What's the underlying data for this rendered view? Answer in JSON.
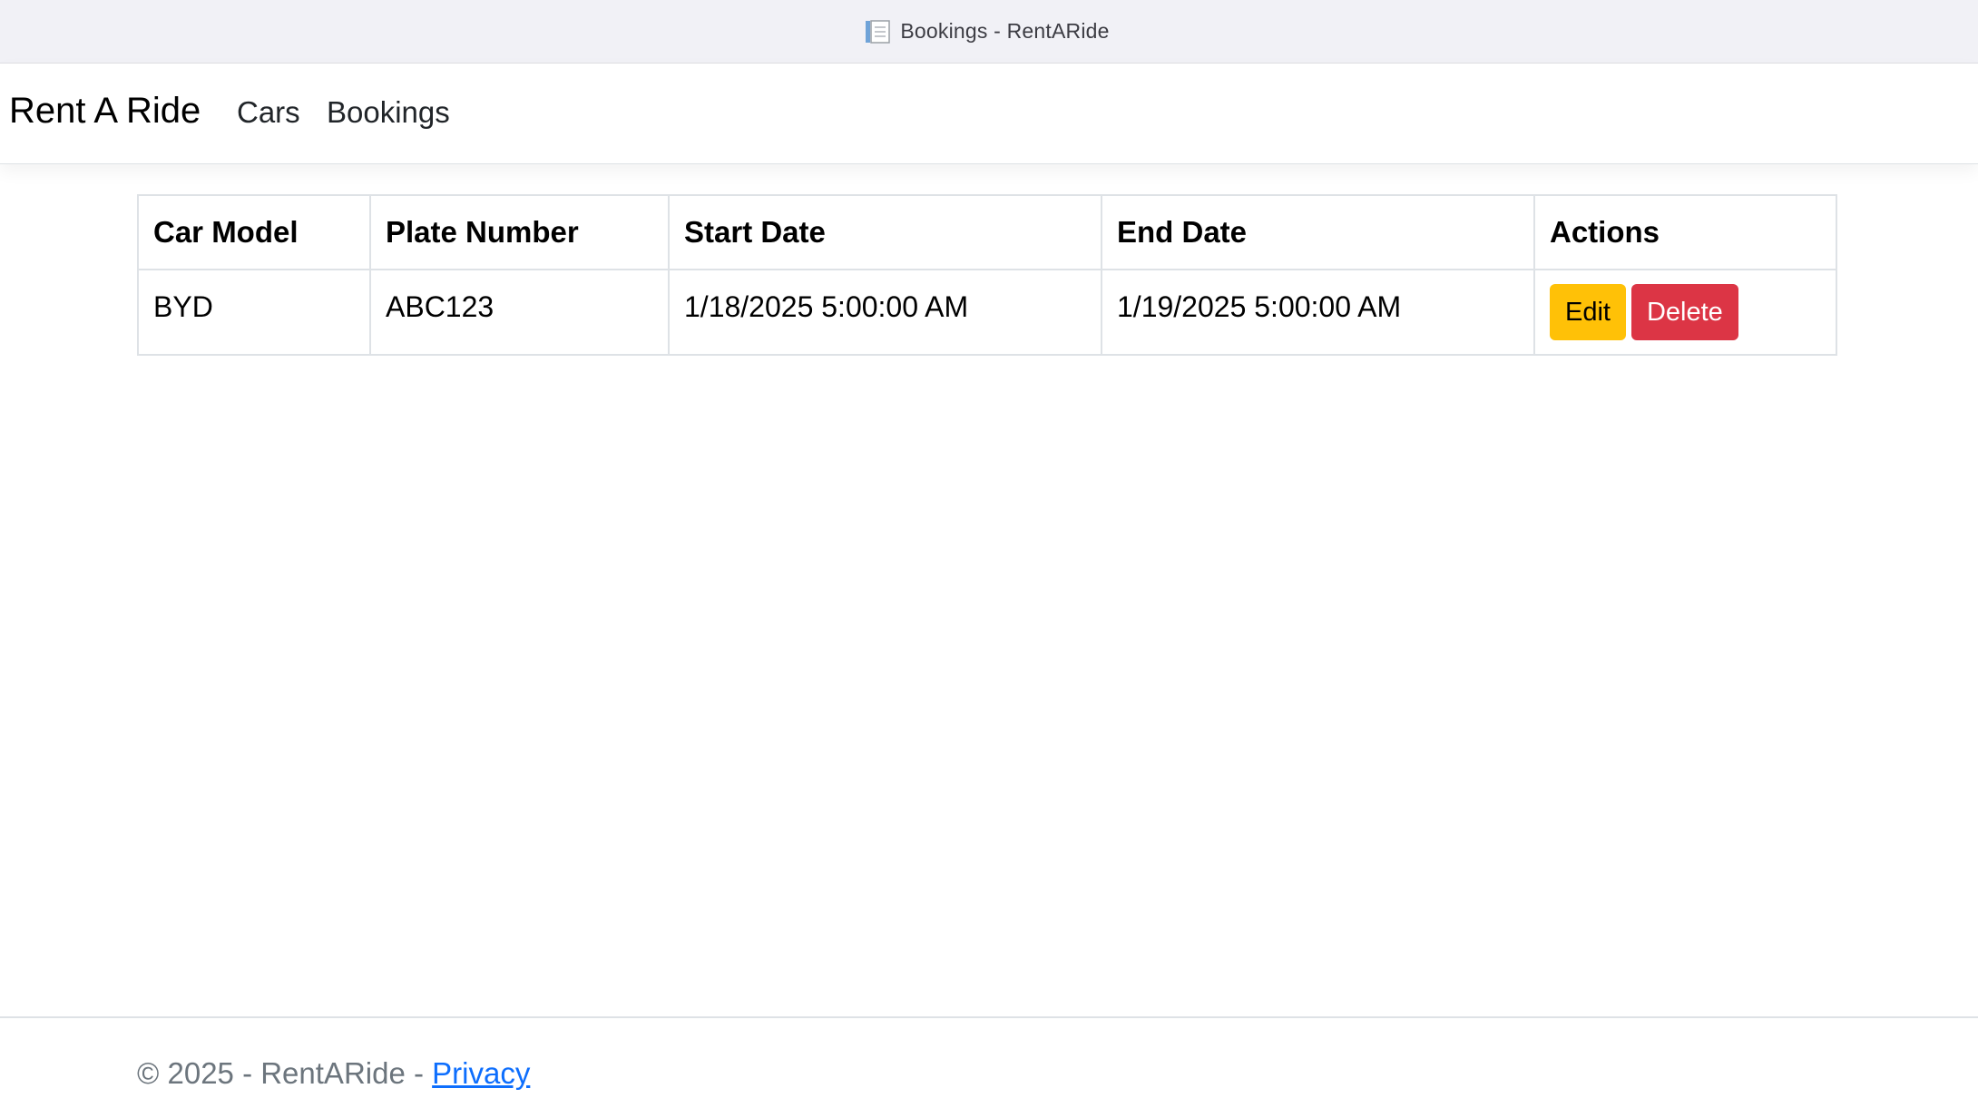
{
  "window": {
    "title": "Bookings - RentARide",
    "icon": "document-icon"
  },
  "navbar": {
    "brand": "Rent A Ride",
    "links": [
      {
        "label": "Cars"
      },
      {
        "label": "Bookings"
      }
    ]
  },
  "bookings_table": {
    "columns": [
      "Car Model",
      "Plate Number",
      "Start Date",
      "End Date",
      "Actions"
    ],
    "rows": [
      {
        "car_model": "BYD",
        "plate_number": "ABC123",
        "start_date": "1/18/2025 5:00:00 AM",
        "end_date": "1/19/2025 5:00:00 AM",
        "edit_label": "Edit",
        "delete_label": "Delete"
      }
    ]
  },
  "footer": {
    "copyright": "© 2025 - RentARide - ",
    "privacy_link": "Privacy"
  },
  "colors": {
    "edit_button": "#ffc107",
    "delete_button": "#dc3545",
    "link": "#0d6efd"
  }
}
